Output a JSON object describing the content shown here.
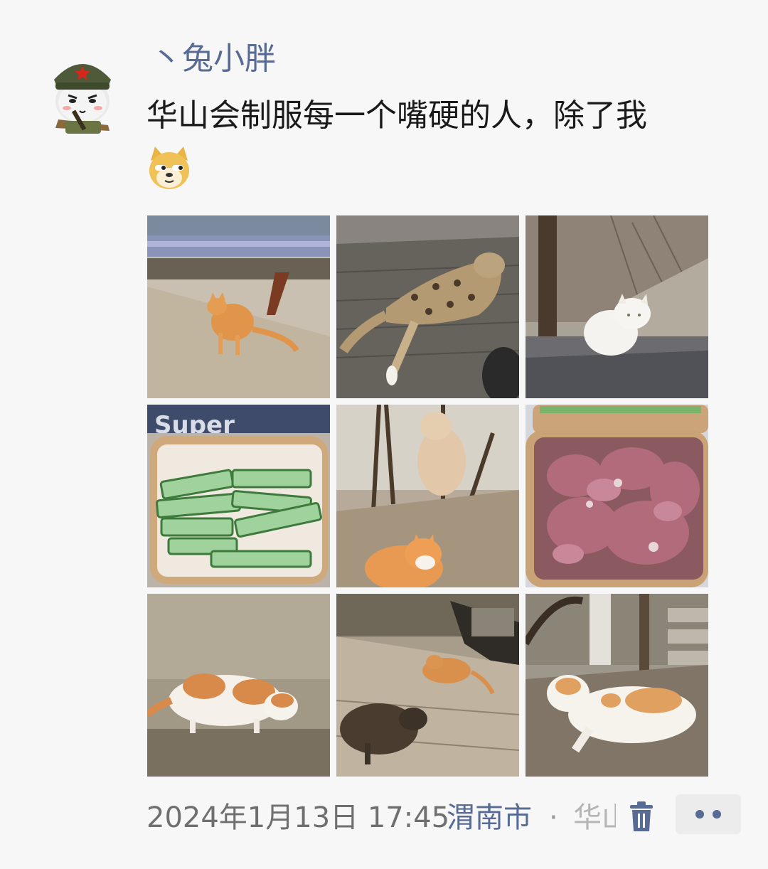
{
  "post": {
    "username": "丶兔小胖",
    "text": "华山会制服每一个嘴硬的人，除了我",
    "emoji_icon": "doge-emoji-icon",
    "photos": [
      {
        "name": "photo-orange-cat-by-bench"
      },
      {
        "name": "photo-tabby-cat-lying"
      },
      {
        "name": "photo-white-cat-sitting"
      },
      {
        "name": "photo-cucumber-slices"
      },
      {
        "name": "photo-two-cats-by-tree"
      },
      {
        "name": "photo-raw-meat"
      },
      {
        "name": "photo-calico-cat-walking"
      },
      {
        "name": "photo-cats-on-stone-path"
      },
      {
        "name": "photo-calico-cat-lying"
      }
    ],
    "footer": {
      "time": "2024年1月13日 17:45",
      "location": "渭南市",
      "separator": "·",
      "location_detail": "华山",
      "delete_icon": "trash-icon",
      "more_icon": "more-dots-icon"
    }
  },
  "colors": {
    "link": "#576b95",
    "background": "#f7f7f7",
    "text": "#1a1a1a",
    "meta": "#6f6f6f"
  }
}
